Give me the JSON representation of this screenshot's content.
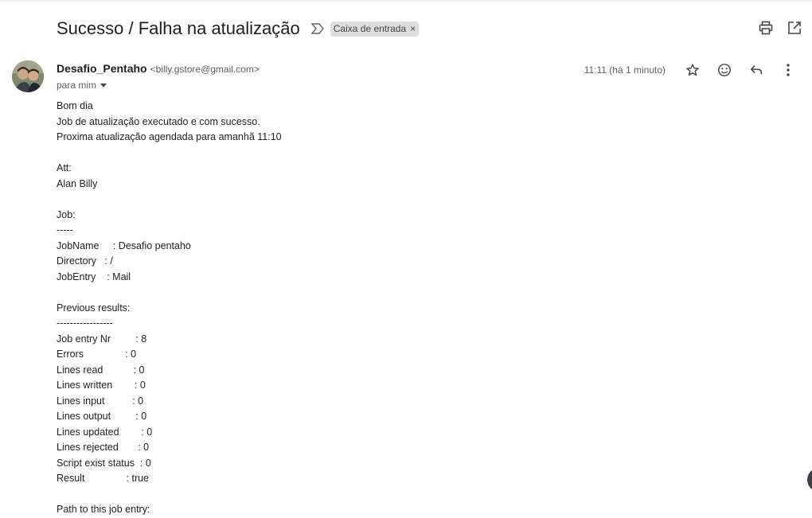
{
  "email": {
    "subject": "Sucesso / Falha na atualização",
    "label": "Caixa de entrada",
    "label_remove": "×",
    "sender_name": "Desafio_Pentaho",
    "sender_email": "<billy.gstore@gmail.com>",
    "recipient": "para mim",
    "timestamp": "11:11 (há 1 minuto)"
  },
  "icons": {
    "importance": "importance-marker-icon",
    "print": "print-icon",
    "popout": "open-in-new-window-icon",
    "star": "star-icon",
    "emoji": "emoji-reaction-icon",
    "reply": "reply-icon",
    "more": "more-vertical-icon"
  },
  "body": {
    "lines": [
      "Bom dia",
      "Job de atualização executado e com sucesso.",
      "Proxima atualização agendada para amanhã 11:10",
      "",
      "Att:",
      "Alan Billy",
      "",
      "Job:",
      "-----",
      "JobName     : Desafio pentaho",
      "Directory   : /",
      "JobEntry    : Mail",
      "",
      "Previous results:",
      "-----------------",
      "Job entry Nr         : 8",
      "Errors               : 0",
      "Lines read           : 0",
      "Lines written        : 0",
      "Lines input          : 0",
      "Lines output         : 0",
      "Lines updated        : 0",
      "Lines rejected       : 0",
      "Script exist status  : 0",
      "Result               : true",
      "",
      "Path to this job entry:"
    ]
  }
}
